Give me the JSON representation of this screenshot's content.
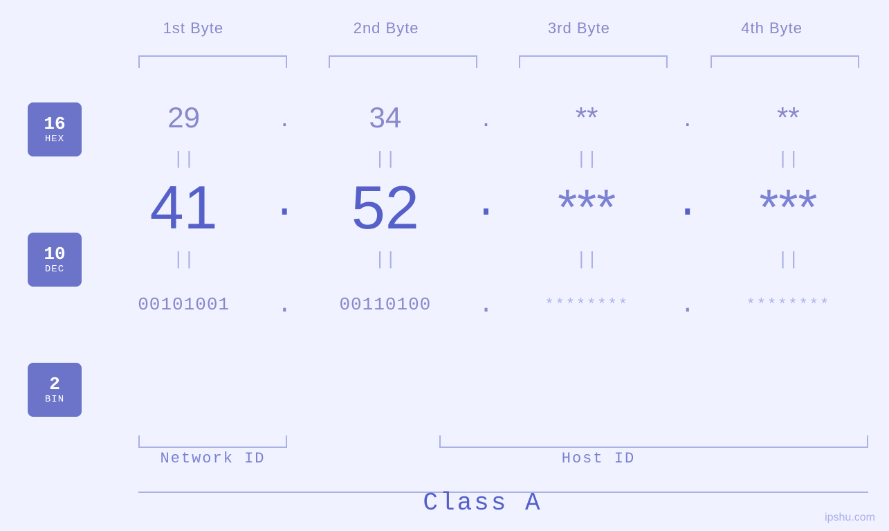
{
  "header": {
    "byte1_label": "1st Byte",
    "byte2_label": "2nd Byte",
    "byte3_label": "3rd Byte",
    "byte4_label": "4th Byte"
  },
  "badges": {
    "hex": {
      "num": "16",
      "label": "HEX"
    },
    "dec": {
      "num": "10",
      "label": "DEC"
    },
    "bin": {
      "num": "2",
      "label": "BIN"
    }
  },
  "hex_row": {
    "b1": "29",
    "dot1": ".",
    "b2": "34",
    "dot2": ".",
    "b3": "**",
    "dot3": ".",
    "b4": "**"
  },
  "dec_row": {
    "b1": "41",
    "dot1": ".",
    "b2": "52",
    "dot2": ".",
    "b3": "***",
    "dot3": ".",
    "b4": "***"
  },
  "bin_row": {
    "b1": "00101001",
    "dot1": ".",
    "b2": "00110100",
    "dot2": ".",
    "b3": "********",
    "dot3": ".",
    "b4": "********"
  },
  "equals_symbol": "||",
  "labels": {
    "network_id": "Network ID",
    "host_id": "Host ID",
    "class": "Class A"
  },
  "watermark": "ipshu.com"
}
